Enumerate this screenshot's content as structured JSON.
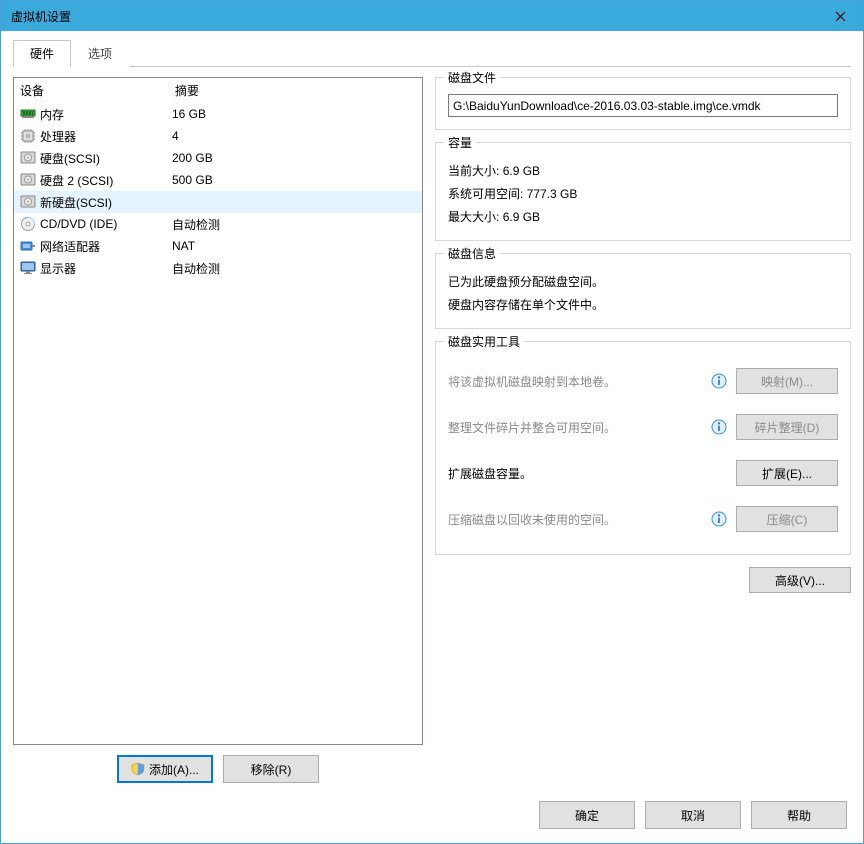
{
  "window": {
    "title": "虚拟机设置"
  },
  "tabs": {
    "hardware": "硬件",
    "options": "选项"
  },
  "device_list": {
    "col_device": "设备",
    "col_summary": "摘要",
    "items": [
      {
        "name": "内存",
        "summary": "16 GB",
        "icon": "memory"
      },
      {
        "name": "处理器",
        "summary": "4",
        "icon": "cpu"
      },
      {
        "name": "硬盘(SCSI)",
        "summary": "200 GB",
        "icon": "disk"
      },
      {
        "name": "硬盘 2 (SCSI)",
        "summary": "500 GB",
        "icon": "disk"
      },
      {
        "name": "新硬盘(SCSI)",
        "summary": "",
        "icon": "disk",
        "selected": true
      },
      {
        "name": "CD/DVD (IDE)",
        "summary": "自动检测",
        "icon": "cd"
      },
      {
        "name": "网络适配器",
        "summary": "NAT",
        "icon": "net"
      },
      {
        "name": "显示器",
        "summary": "自动检测",
        "icon": "display"
      }
    ]
  },
  "left_buttons": {
    "add": "添加(A)...",
    "remove": "移除(R)"
  },
  "disk_file": {
    "title": "磁盘文件",
    "value": "G:\\BaiduYunDownload\\ce-2016.03.03-stable.img\\ce.vmdk"
  },
  "capacity": {
    "title": "容量",
    "current_label": "当前大小:",
    "current_value": "6.9 GB",
    "free_label": "系统可用空间:",
    "free_value": "777.3 GB",
    "max_label": "最大大小:",
    "max_value": "6.9 GB"
  },
  "disk_info": {
    "title": "磁盘信息",
    "line1": "已为此硬盘预分配磁盘空间。",
    "line2": "硬盘内容存储在单个文件中。"
  },
  "utilities": {
    "title": "磁盘实用工具",
    "map_text": "将该虚拟机磁盘映射到本地卷。",
    "map_btn": "映射(M)...",
    "defrag_text": "整理文件碎片并整合可用空间。",
    "defrag_btn": "碎片整理(D)",
    "expand_text": "扩展磁盘容量。",
    "expand_btn": "扩展(E)...",
    "compress_text": "压缩磁盘以回收未使用的空间。",
    "compress_btn": "压缩(C)"
  },
  "advanced_btn": "高级(V)...",
  "footer": {
    "ok": "确定",
    "cancel": "取消",
    "help": "帮助"
  }
}
